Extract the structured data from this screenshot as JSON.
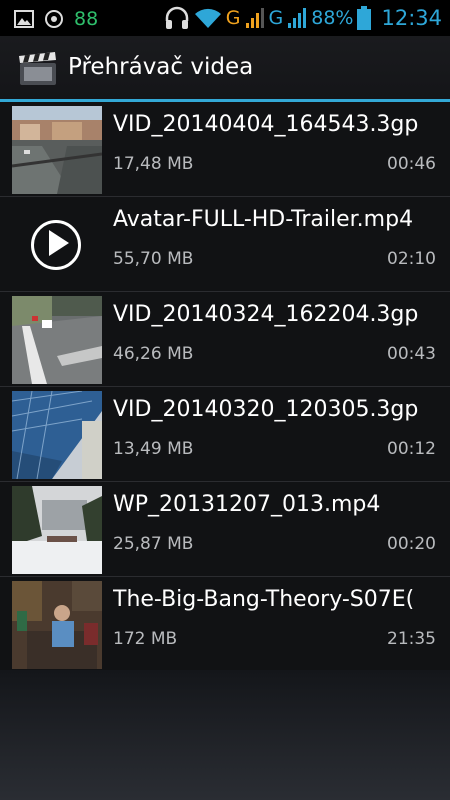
{
  "status_bar": {
    "battery_notification": "88",
    "network_1": "G",
    "network_2": "G",
    "battery_percent": "88%",
    "time": "12:34",
    "icons": [
      "image-icon",
      "circle-icon",
      "headset-icon",
      "wifi-icon",
      "signal-icon",
      "signal-icon",
      "battery-icon"
    ]
  },
  "action_bar": {
    "title": "Přehrávač videa",
    "icon": "clapperboard-icon"
  },
  "videos": [
    {
      "title": "VID_20140404_164543.3gp",
      "size": "17,48 MB",
      "duration": "00:46",
      "thumb": "street-thumb"
    },
    {
      "title": "Avatar-FULL-HD-Trailer.mp4",
      "size": "55,70 MB",
      "duration": "02:10",
      "thumb": "play-icon"
    },
    {
      "title": "VID_20140324_162204.3gp",
      "size": "46,26 MB",
      "duration": "00:43",
      "thumb": "road-thumb"
    },
    {
      "title": "VID_20140320_120305.3gp",
      "size": "13,49 MB",
      "duration": "00:12",
      "thumb": "tower-thumb"
    },
    {
      "title": "WP_20131207_013.mp4",
      "size": "25,87 MB",
      "duration": "00:20",
      "thumb": "snow-thumb"
    },
    {
      "title": "The-Big-Bang-Theory-S07E(",
      "size": "172 MB",
      "duration": "21:35",
      "thumb": "room-thumb"
    }
  ],
  "colors": {
    "accent": "#33a9d6",
    "status_blue": "#2ea7d8",
    "status_orange": "#f0a21e"
  }
}
